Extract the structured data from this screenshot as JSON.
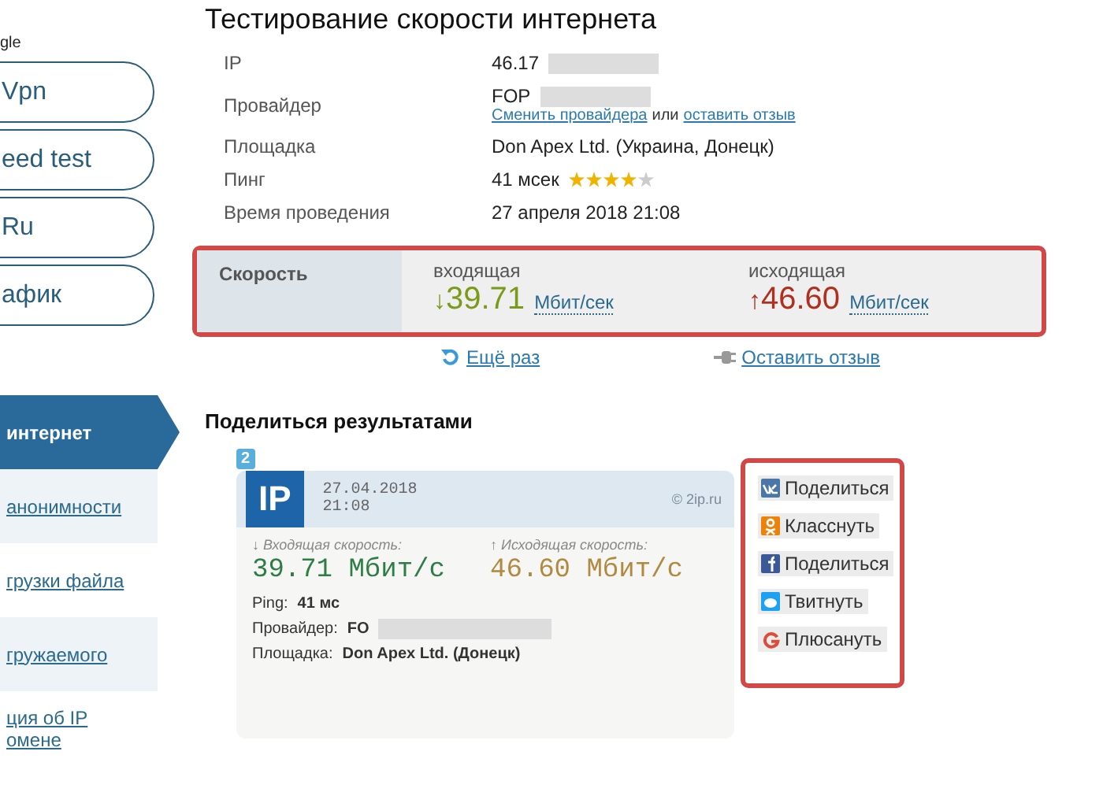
{
  "sidebar": {
    "caption": "gle",
    "pills": [
      "Vpn",
      "eed test",
      "Ru",
      "афик"
    ],
    "nav": [
      {
        "label": "интернет",
        "selected": true
      },
      {
        "label": "анонимности",
        "selected": false
      },
      {
        "label": "грузки файла",
        "selected": false
      },
      {
        "label": "гружаемого",
        "selected": false
      },
      {
        "label": "ция об IP\nомене",
        "selected": false
      }
    ]
  },
  "title": "Тестирование скорости интернета",
  "info": [
    {
      "label": "IP",
      "value": "46.17",
      "redacted": true
    },
    {
      "label": "Провайдер",
      "value": "FOP",
      "redacted": true,
      "links": {
        "change": "Сменить провайдера",
        "or": "или",
        "review": "оставить отзыв"
      }
    },
    {
      "label": "Площадка",
      "value": "Don Apex Ltd. (Украина, Донецк)",
      "redacted": false
    },
    {
      "label": "Пинг",
      "value": "41 мсек",
      "redacted": false,
      "stars": 4
    },
    {
      "label": "Время проведения",
      "value": "27 апреля 2018 21:08",
      "redacted": false
    }
  ],
  "speed": {
    "label": "Скорость",
    "items": [
      {
        "kind": "down",
        "caption": "входящая",
        "arrow": "↓",
        "value": "39.71",
        "unit": "Мбит/сек"
      },
      {
        "kind": "up",
        "caption": "исходящая",
        "arrow": "↑",
        "value": "46.60",
        "unit": "Мбит/сек"
      }
    ]
  },
  "actions": {
    "again": "Ещё раз",
    "review": "Оставить отзыв"
  },
  "share": {
    "title": "Поделиться результатами",
    "card": {
      "badge": "2",
      "logo": "IP",
      "date": "27.04.2018",
      "time": "21:08",
      "site": "© 2ip.ru",
      "down_caption": "↓ Входящая скорость:",
      "up_caption": "↑ Исходящая скорость:",
      "down_value": "39.71 Мбит/с",
      "up_value": "46.60 Мбит/с",
      "rows": [
        {
          "label": "Ping:",
          "value": "41 мс",
          "redacted": false
        },
        {
          "label": "Провайдер:",
          "value": "FO",
          "redacted": true
        },
        {
          "label": "Площадка:",
          "value": "Don Apex Ltd. (Донецк)",
          "redacted": false
        }
      ]
    },
    "buttons": [
      {
        "kind": "vk",
        "label": "Поделиться"
      },
      {
        "kind": "ok",
        "label": "Класснуть"
      },
      {
        "kind": "fb",
        "label": "Поделиться"
      },
      {
        "kind": "tw",
        "label": "Твитнуть"
      },
      {
        "kind": "gp",
        "label": "Плюсануть"
      }
    ]
  }
}
